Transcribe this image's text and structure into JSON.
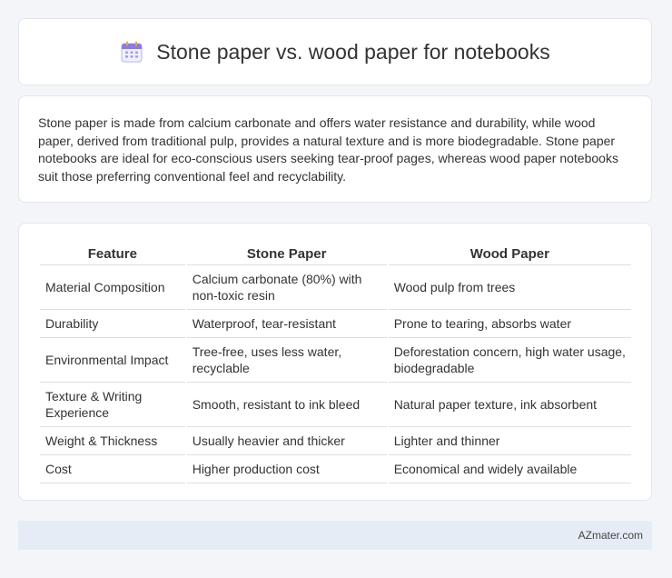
{
  "header": {
    "title": "Stone paper vs. wood paper for notebooks",
    "icon": "calendar-icon"
  },
  "summary": {
    "text": "Stone paper is made from calcium carbonate and offers water resistance and durability, while wood paper, derived from traditional pulp, provides a natural texture and is more biodegradable. Stone paper notebooks are ideal for eco-conscious users seeking tear-proof pages, whereas wood paper notebooks suit those preferring conventional feel and recyclability."
  },
  "table": {
    "headers": [
      "Feature",
      "Stone Paper",
      "Wood Paper"
    ],
    "rows": [
      [
        "Material Composition",
        "Calcium carbonate (80%) with non-toxic resin",
        "Wood pulp from trees"
      ],
      [
        "Durability",
        "Waterproof, tear-resistant",
        "Prone to tearing, absorbs water"
      ],
      [
        "Environmental Impact",
        "Tree-free, uses less water, recyclable",
        "Deforestation concern, high water usage, biodegradable"
      ],
      [
        "Texture & Writing Experience",
        "Smooth, resistant to ink bleed",
        "Natural paper texture, ink absorbent"
      ],
      [
        "Weight & Thickness",
        "Usually heavier and thicker",
        "Lighter and thinner"
      ],
      [
        "Cost",
        "Higher production cost",
        "Economical and widely available"
      ]
    ]
  },
  "footer": {
    "text": "AZmater.com"
  },
  "colors": {
    "background": "#f3f5f9",
    "card": "#ffffff",
    "footer": "#e6ecf6",
    "icon_accent": "#8a7fd8"
  }
}
